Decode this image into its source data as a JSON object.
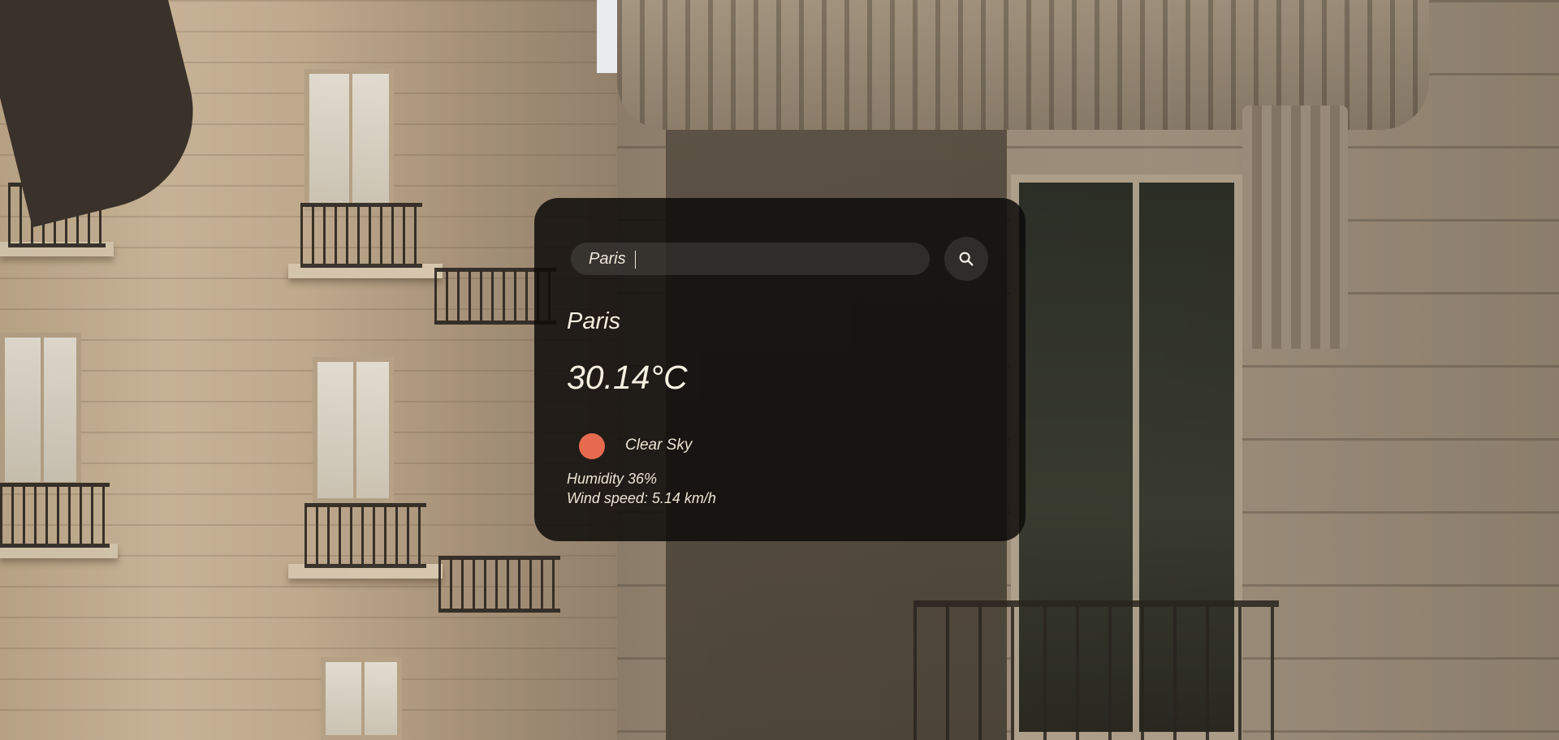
{
  "search": {
    "value": "Paris",
    "button_icon": "search-icon"
  },
  "weather": {
    "city": "Paris",
    "temperature": "30.14°C",
    "icon": "sun-icon",
    "icon_color": "#e66a4d",
    "description": "Clear Sky",
    "humidity": "Humidity 36%",
    "wind": "Wind speed: 5.14 km/h"
  },
  "card": {
    "background": "#0e0c0b"
  }
}
